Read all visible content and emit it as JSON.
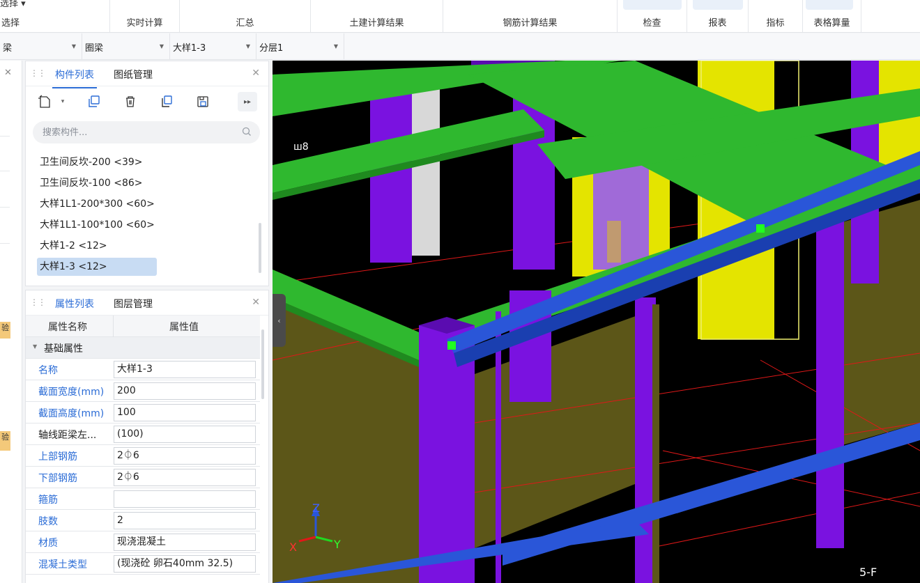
{
  "ribbon": {
    "top_fragment": "选择 ▾",
    "groups": [
      {
        "label": "选择"
      },
      {
        "label": "实时计算"
      },
      {
        "label": "汇总"
      },
      {
        "label": "土建计算结果"
      },
      {
        "label": "钢筋计算结果"
      },
      {
        "label": "检查"
      },
      {
        "label": "报表"
      },
      {
        "label": "指标"
      },
      {
        "label": "表格算量"
      }
    ]
  },
  "selectors": [
    {
      "value": "梁"
    },
    {
      "value": "圈梁"
    },
    {
      "value": "大样1-3"
    },
    {
      "value": "分层1"
    }
  ],
  "left_stub": {
    "tab1": "验",
    "tab2": "验"
  },
  "component_panel": {
    "tabs": [
      "构件列表",
      "图纸管理"
    ],
    "search_placeholder": "搜索构件...",
    "items": [
      {
        "label": "卫生间反坎-200 <39>"
      },
      {
        "label": "卫生间反坎-100 <86>"
      },
      {
        "label": "大样1L1-200*300 <60>"
      },
      {
        "label": "大样1L1-100*100 <60>"
      },
      {
        "label": "大样1-2 <12>"
      },
      {
        "label": "大样1-3 <12>"
      }
    ],
    "selected_index": 5
  },
  "property_panel": {
    "tabs": [
      "属性列表",
      "图层管理"
    ],
    "col_name": "属性名称",
    "col_value": "属性值",
    "section": "基础属性",
    "rows": [
      {
        "name": "名称",
        "value": "大样1-3",
        "blue": true
      },
      {
        "name": "截面宽度(mm)",
        "value": "200",
        "blue": true
      },
      {
        "name": "截面高度(mm)",
        "value": "100",
        "blue": true
      },
      {
        "name": "轴线距梁左...",
        "value": "(100)",
        "blue": false
      },
      {
        "name": "上部钢筋",
        "value": "2⏀6",
        "blue": true
      },
      {
        "name": "下部钢筋",
        "value": "2⏀6",
        "blue": true
      },
      {
        "name": "箍筋",
        "value": "",
        "blue": true
      },
      {
        "name": "肢数",
        "value": "2",
        "blue": true
      },
      {
        "name": "材质",
        "value": "现浇混凝土",
        "blue": true
      },
      {
        "name": "混凝土类型",
        "value": "(现浇砼 卵石40mm 32.5)",
        "blue": true
      }
    ]
  },
  "viewport": {
    "label_topleft": "ш8",
    "label_bottomright": "5-F",
    "axis_z": "Z",
    "axis_x": "X",
    "axis_y": "Y"
  },
  "colors": {
    "accent": "#2b6cd6",
    "beam_green": "#2fb82f",
    "column_purple": "#7a12e0",
    "highlight_yellow": "#e4e400",
    "rail_blue": "#2a56d8",
    "wall_olive": "#5c5618"
  }
}
